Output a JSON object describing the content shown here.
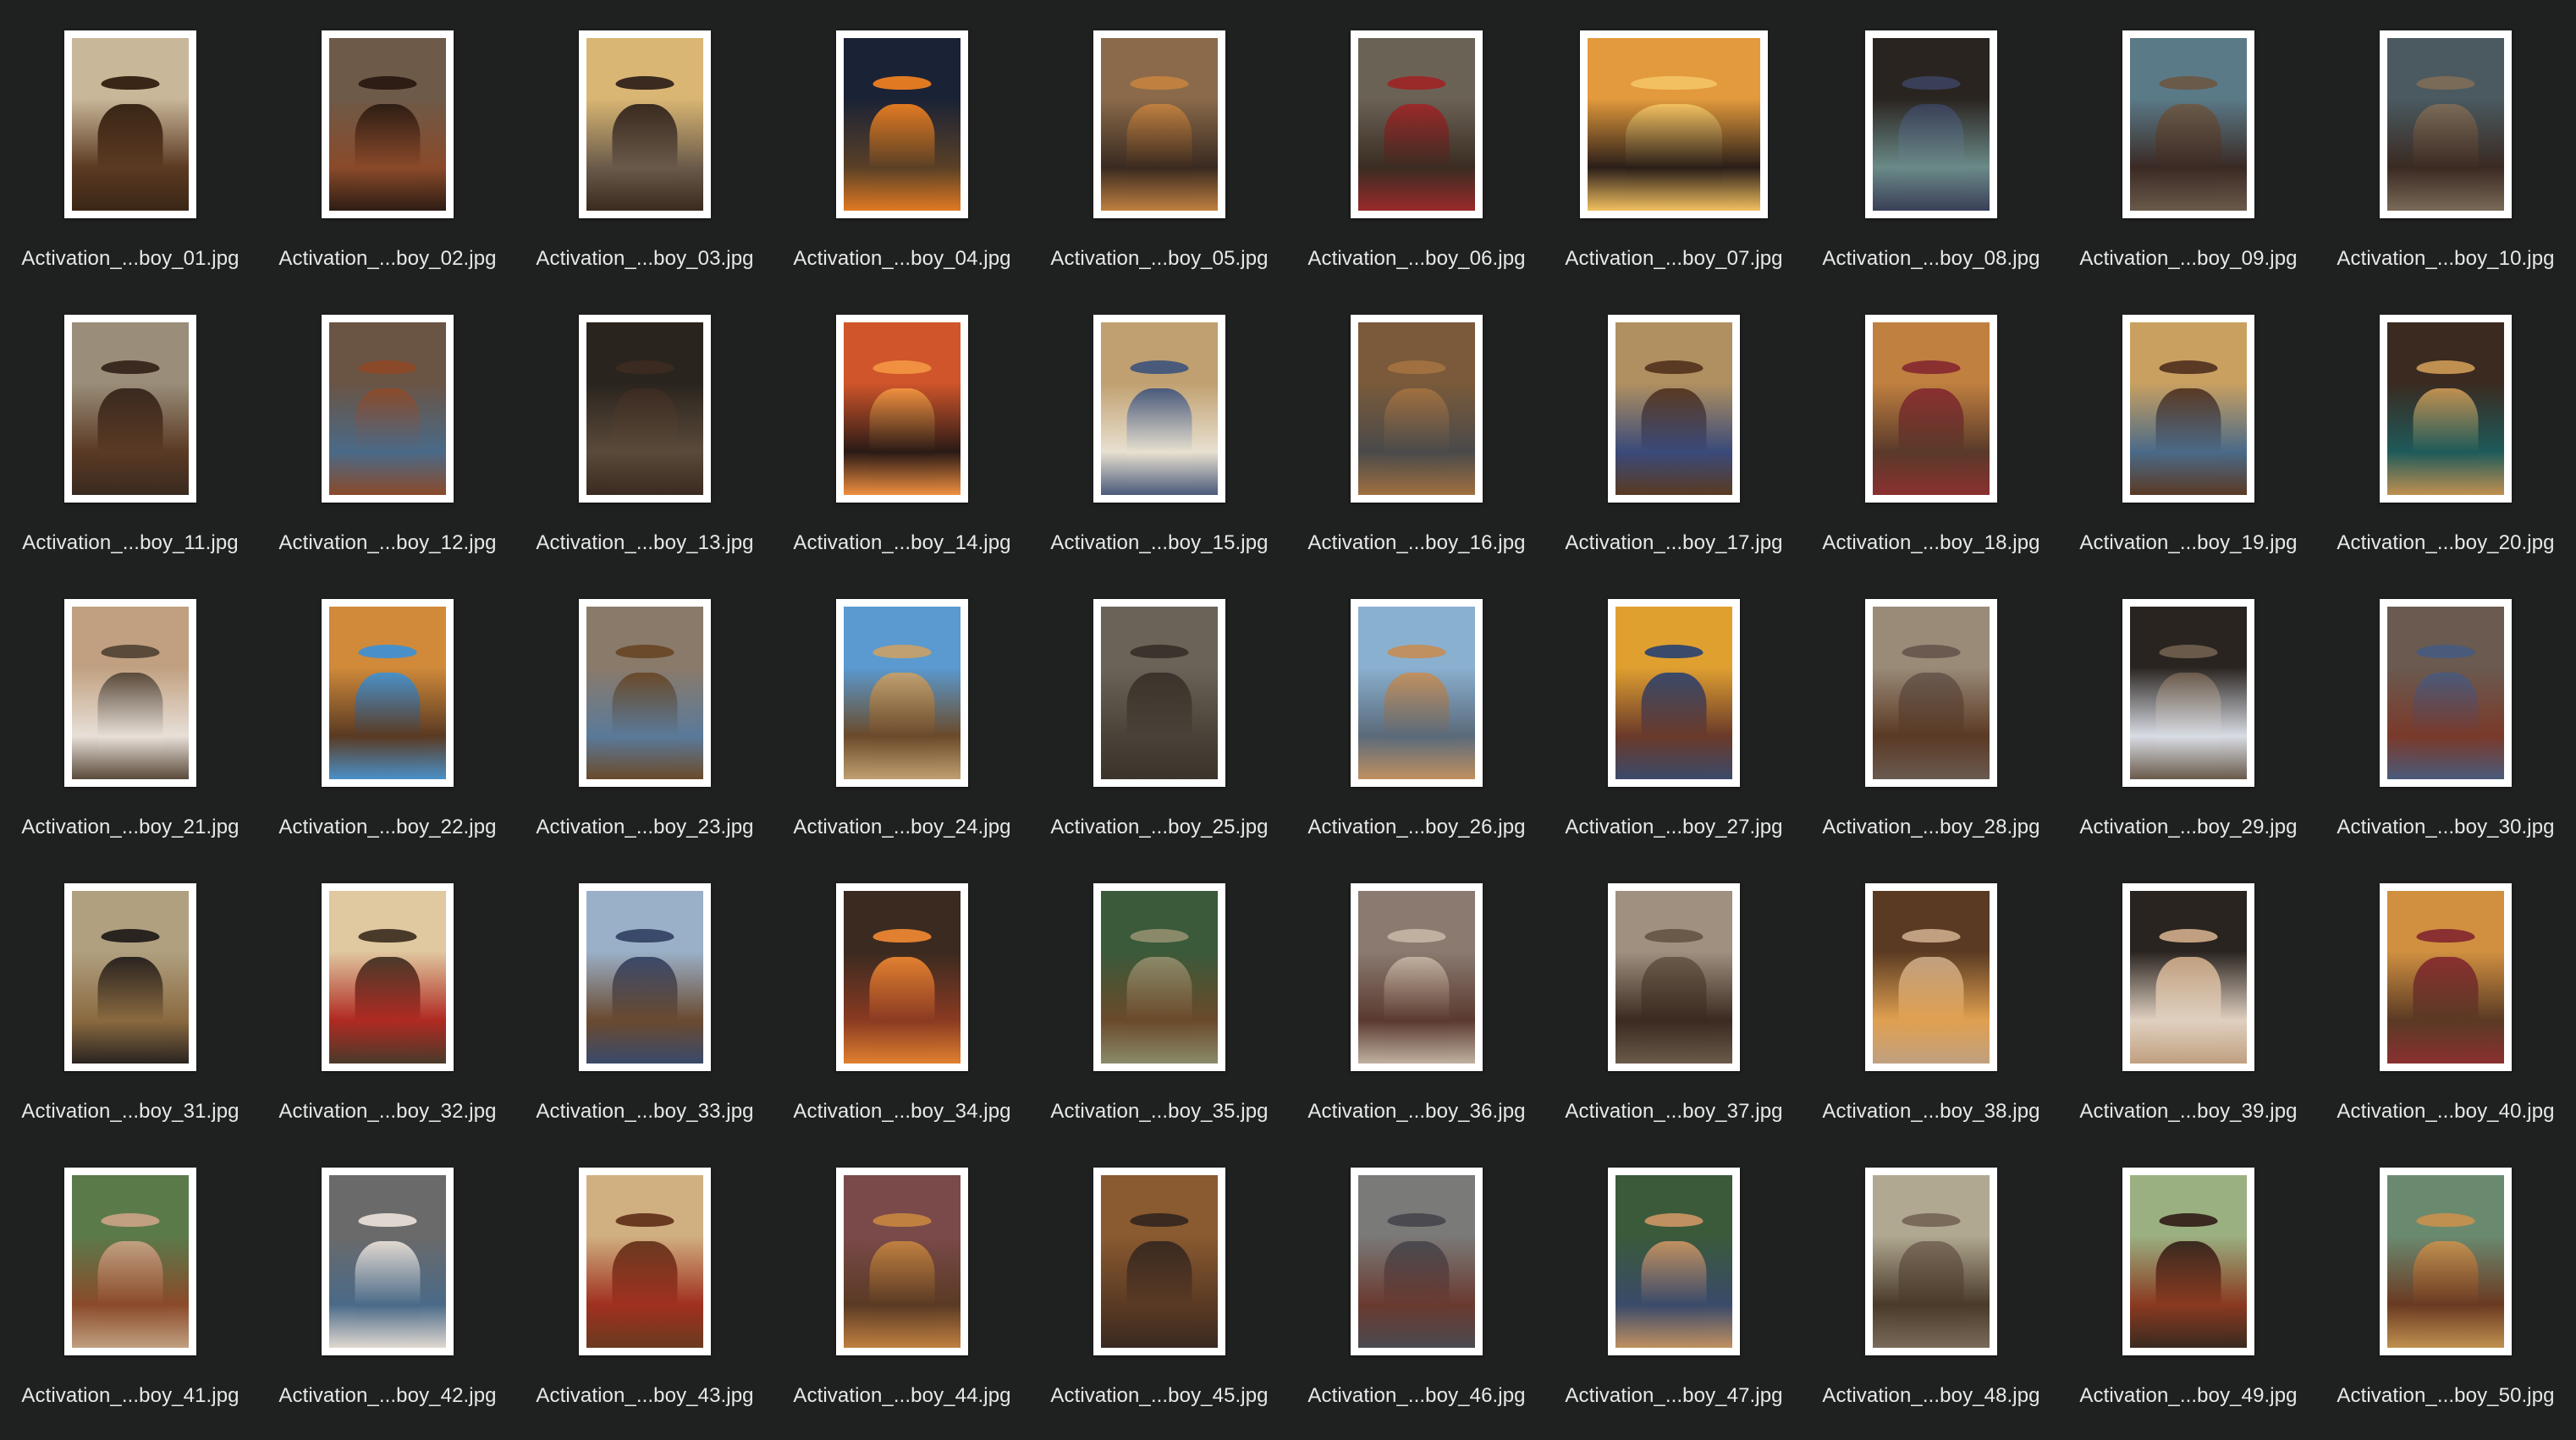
{
  "window": {
    "view": "icon-grid",
    "background": "#1f2120"
  },
  "files": [
    {
      "name": "Activation_...boy_01.jpg",
      "icon": "photo-thumbnail",
      "palette": [
        "#c9b79a",
        "#5b3a22",
        "#3a2616"
      ]
    },
    {
      "name": "Activation_...boy_02.jpg",
      "icon": "photo-thumbnail",
      "palette": [
        "#6e5a48",
        "#8a4a2a",
        "#2e1d14"
      ]
    },
    {
      "name": "Activation_...boy_03.jpg",
      "icon": "photo-thumbnail",
      "palette": [
        "#d9b673",
        "#6a5a4a",
        "#3a2a1f"
      ]
    },
    {
      "name": "Activation_...boy_04.jpg",
      "icon": "photo-thumbnail",
      "palette": [
        "#1a2236",
        "#5a4026",
        "#e07a22"
      ]
    },
    {
      "name": "Activation_...boy_05.jpg",
      "icon": "photo-thumbnail",
      "palette": [
        "#8a6a4a",
        "#3a2a20",
        "#c08040"
      ]
    },
    {
      "name": "Activation_...boy_06.jpg",
      "icon": "photo-thumbnail",
      "palette": [
        "#6b6256",
        "#3a2c22",
        "#9a2a2a"
      ]
    },
    {
      "name": "Activation_...boy_07.jpg",
      "icon": "photo-thumbnail",
      "palette": [
        "#e39a3c",
        "#2a1e18",
        "#f2c060"
      ],
      "landscape": true
    },
    {
      "name": "Activation_...boy_08.jpg",
      "icon": "photo-thumbnail",
      "palette": [
        "#2a2420",
        "#6a8a88",
        "#3a3f58"
      ]
    },
    {
      "name": "Activation_...boy_09.jpg",
      "icon": "photo-thumbnail",
      "palette": [
        "#5a7a88",
        "#3a2a24",
        "#6a5a4a"
      ]
    },
    {
      "name": "Activation_...boy_10.jpg",
      "icon": "photo-thumbnail",
      "palette": [
        "#4a5a60",
        "#3a2a22",
        "#7a6a58"
      ]
    },
    {
      "name": "Activation_...boy_11.jpg",
      "icon": "photo-thumbnail",
      "palette": [
        "#9a8e7a",
        "#5a3a24",
        "#3a2a20"
      ]
    },
    {
      "name": "Activation_...boy_12.jpg",
      "icon": "photo-thumbnail",
      "palette": [
        "#6a5444",
        "#4a6a88",
        "#8a4a2a"
      ]
    },
    {
      "name": "Activation_...boy_13.jpg",
      "icon": "photo-thumbnail",
      "palette": [
        "#2a241e",
        "#5a4a3a",
        "#3a2a20"
      ]
    },
    {
      "name": "Activation_...boy_14.jpg",
      "icon": "photo-thumbnail",
      "palette": [
        "#d0552a",
        "#2a1a16",
        "#f09040"
      ]
    },
    {
      "name": "Activation_...boy_15.jpg",
      "icon": "photo-thumbnail",
      "palette": [
        "#c0a070",
        "#e8e0d0",
        "#4a5a7a"
      ]
    },
    {
      "name": "Activation_...boy_16.jpg",
      "icon": "photo-thumbnail",
      "palette": [
        "#7a5a3a",
        "#4a4a4a",
        "#a07040"
      ]
    },
    {
      "name": "Activation_...boy_17.jpg",
      "icon": "photo-thumbnail",
      "palette": [
        "#b09060",
        "#3a4a7a",
        "#5a3a22"
      ]
    },
    {
      "name": "Activation_...boy_18.jpg",
      "icon": "photo-thumbnail",
      "palette": [
        "#c08040",
        "#5a3a2a",
        "#8a3030"
      ]
    },
    {
      "name": "Activation_...boy_19.jpg",
      "icon": "photo-thumbnail",
      "palette": [
        "#c9a060",
        "#4a6a88",
        "#5a3a24"
      ]
    },
    {
      "name": "Activation_...boy_20.jpg",
      "icon": "photo-thumbnail",
      "palette": [
        "#3a2a20",
        "#1e5a5a",
        "#c09050"
      ]
    },
    {
      "name": "Activation_...boy_21.jpg",
      "icon": "photo-thumbnail",
      "palette": [
        "#c0a080",
        "#e8e0d8",
        "#5a4a3a"
      ]
    },
    {
      "name": "Activation_...boy_22.jpg",
      "icon": "photo-thumbnail",
      "palette": [
        "#d08a3a",
        "#5a3a22",
        "#4a90c8"
      ]
    },
    {
      "name": "Activation_...boy_23.jpg",
      "icon": "photo-thumbnail",
      "palette": [
        "#8a7a6a",
        "#5a7a9a",
        "#6a4a2a"
      ]
    },
    {
      "name": "Activation_...boy_24.jpg",
      "icon": "photo-thumbnail",
      "palette": [
        "#5a9ad0",
        "#6a4a2a",
        "#c0a070"
      ]
    },
    {
      "name": "Activation_...boy_25.jpg",
      "icon": "photo-thumbnail",
      "palette": [
        "#6a6458",
        "#4a4238",
        "#3a342c"
      ]
    },
    {
      "name": "Activation_...boy_26.jpg",
      "icon": "photo-thumbnail",
      "palette": [
        "#8ab0d0",
        "#5a6a7a",
        "#c09060"
      ]
    },
    {
      "name": "Activation_...boy_27.jpg",
      "icon": "photo-thumbnail",
      "palette": [
        "#e0a030",
        "#6a3a2a",
        "#3a4a6a"
      ]
    },
    {
      "name": "Activation_...boy_28.jpg",
      "icon": "photo-thumbnail",
      "palette": [
        "#9a8a78",
        "#5a3a24",
        "#6a5a50"
      ]
    },
    {
      "name": "Activation_...boy_29.jpg",
      "icon": "photo-thumbnail",
      "palette": [
        "#2a2420",
        "#d8dce4",
        "#6a5a4a"
      ]
    },
    {
      "name": "Activation_...boy_30.jpg",
      "icon": "photo-thumbnail",
      "palette": [
        "#6a5a50",
        "#7a3a2a",
        "#4a5a7a"
      ]
    },
    {
      "name": "Activation_...boy_31.jpg",
      "icon": "photo-thumbnail",
      "palette": [
        "#b0a080",
        "#8a6a40",
        "#2a2420"
      ]
    },
    {
      "name": "Activation_...boy_32.jpg",
      "icon": "photo-thumbnail",
      "palette": [
        "#e0c8a0",
        "#b02a22",
        "#4a3a2a"
      ]
    },
    {
      "name": "Activation_...boy_33.jpg",
      "icon": "photo-thumbnail",
      "palette": [
        "#9ab0c8",
        "#6a4a30",
        "#3a4a6a"
      ]
    },
    {
      "name": "Activation_...boy_34.jpg",
      "icon": "photo-thumbnail",
      "palette": [
        "#3a2a20",
        "#8a3a22",
        "#e08030"
      ]
    },
    {
      "name": "Activation_...boy_35.jpg",
      "icon": "photo-thumbnail",
      "palette": [
        "#3a5a3a",
        "#6a4a2a",
        "#8a8a6a"
      ]
    },
    {
      "name": "Activation_...boy_36.jpg",
      "icon": "photo-thumbnail",
      "palette": [
        "#8a7a70",
        "#5a3a30",
        "#c0b0a0"
      ]
    },
    {
      "name": "Activation_...boy_37.jpg",
      "icon": "photo-thumbnail",
      "palette": [
        "#a09080",
        "#3a2a20",
        "#6a5a4a"
      ]
    },
    {
      "name": "Activation_...boy_38.jpg",
      "icon": "photo-thumbnail",
      "palette": [
        "#5a3a22",
        "#e0a050",
        "#c0a080"
      ]
    },
    {
      "name": "Activation_...boy_39.jpg",
      "icon": "photo-thumbnail",
      "palette": [
        "#2a2420",
        "#e0d0c0",
        "#c0a080"
      ]
    },
    {
      "name": "Activation_...boy_40.jpg",
      "icon": "photo-thumbnail",
      "palette": [
        "#d09040",
        "#5a3a24",
        "#8a3030"
      ]
    },
    {
      "name": "Activation_...boy_41.jpg",
      "icon": "photo-thumbnail",
      "palette": [
        "#5a7a4a",
        "#8a4a2a",
        "#c0a080"
      ]
    },
    {
      "name": "Activation_...boy_42.jpg",
      "icon": "photo-thumbnail",
      "palette": [
        "#6a6a6a",
        "#4a6a88",
        "#e0d8d0"
      ]
    },
    {
      "name": "Activation_...boy_43.jpg",
      "icon": "photo-thumbnail",
      "palette": [
        "#d0b080",
        "#a03020",
        "#6a3a20"
      ]
    },
    {
      "name": "Activation_...boy_44.jpg",
      "icon": "photo-thumbnail",
      "palette": [
        "#7a4a4a",
        "#5a3a24",
        "#c08040"
      ]
    },
    {
      "name": "Activation_...boy_45.jpg",
      "icon": "photo-thumbnail",
      "palette": [
        "#8a5a30",
        "#5a3a24",
        "#3a2a20"
      ]
    },
    {
      "name": "Activation_...boy_46.jpg",
      "icon": "photo-thumbnail",
      "palette": [
        "#7a7a78",
        "#6a3a30",
        "#4a4a50"
      ]
    },
    {
      "name": "Activation_...boy_47.jpg",
      "icon": "photo-thumbnail",
      "palette": [
        "#3a5a3a",
        "#3a4a6a",
        "#c09060"
      ]
    },
    {
      "name": "Activation_...boy_48.jpg",
      "icon": "photo-thumbnail",
      "palette": [
        "#b0a890",
        "#4a3a2a",
        "#7a6a5a"
      ]
    },
    {
      "name": "Activation_...boy_49.jpg",
      "icon": "photo-thumbnail",
      "palette": [
        "#9ab080",
        "#8a3a20",
        "#3a2a20"
      ]
    },
    {
      "name": "Activation_...boy_50.jpg",
      "icon": "photo-thumbnail",
      "palette": [
        "#6a8a70",
        "#6a3a22",
        "#c09050"
      ]
    }
  ]
}
